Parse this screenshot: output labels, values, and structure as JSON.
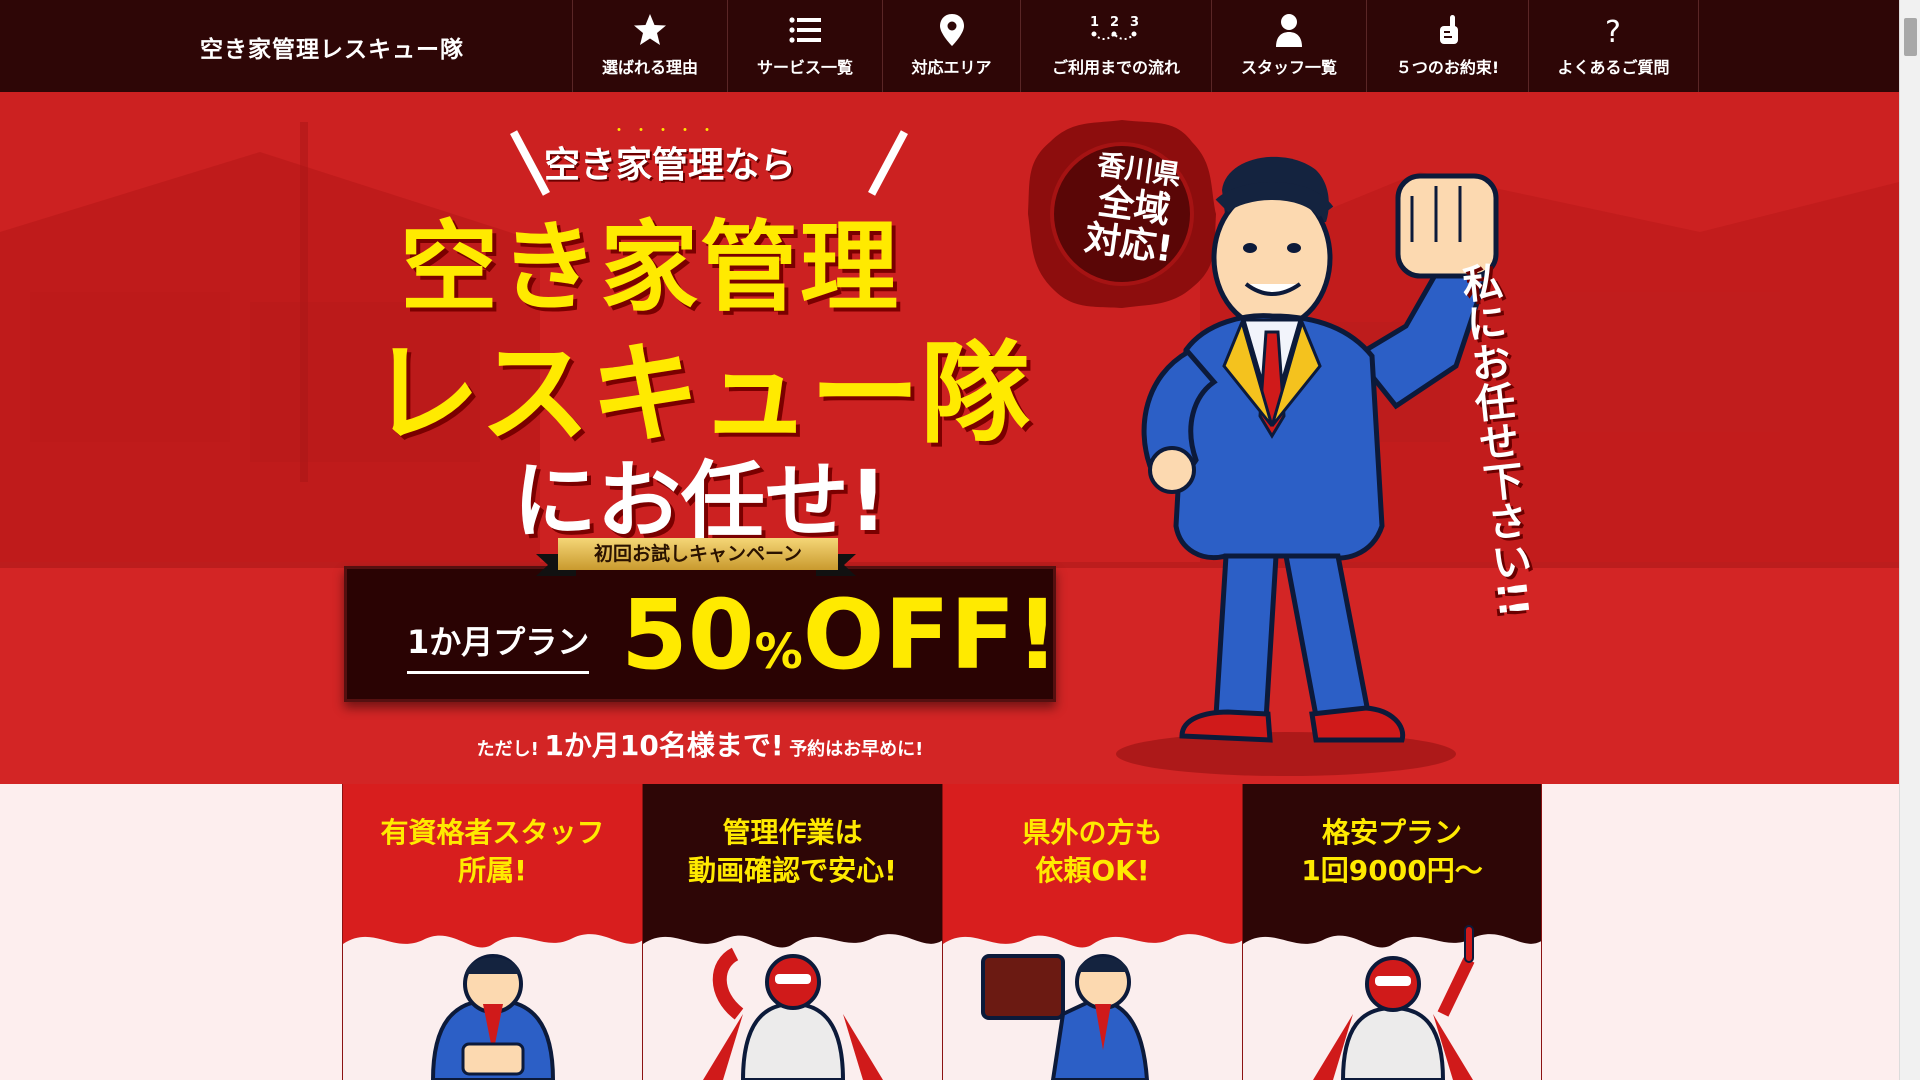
{
  "header": {
    "logo": "空き家管理レスキュー隊",
    "nav": [
      {
        "label": "選ばれる理由",
        "icon": "star-icon"
      },
      {
        "label": "サービス一覧",
        "icon": "list-icon"
      },
      {
        "label": "対応エリア",
        "icon": "map-pin-icon"
      },
      {
        "label": "ご利用までの流れ",
        "icon": "steps-icon"
      },
      {
        "label": "スタッフ一覧",
        "icon": "person-icon"
      },
      {
        "label": "５つのお約束!",
        "icon": "pinky-promise-icon"
      },
      {
        "label": "よくあるご質問",
        "icon": "question-icon"
      }
    ]
  },
  "hero": {
    "catch_dots": "・・・・・",
    "catch": "空き家管理なら",
    "title_line1": "空き家管理",
    "title_line2": "レスキュー隊",
    "title_line3": "にお任せ!",
    "campaign": "初回お試しキャンペーン",
    "plan": "1か月プラン",
    "discount_num": "50",
    "discount_pct": "%",
    "discount_off": "OFF!",
    "note_a": "ただし!",
    "note_b": "1か月10名様まで!",
    "note_c": "予約はお早めに!",
    "seal_line1": "香川県",
    "seal_line2": "全域",
    "seal_line3": "対応!",
    "vertical_text": "私にお任せ下さい!!"
  },
  "features": [
    {
      "line1": "有資格者スタッフ",
      "line2": "所属!",
      "theme": "red"
    },
    {
      "line1": "管理作業は",
      "line2": "動画確認で安心!",
      "theme": "dark"
    },
    {
      "line1": "県外の方も",
      "line2": "依頼OK!",
      "theme": "red"
    },
    {
      "line1": "格安プラン",
      "line2": "1回9000円〜",
      "theme": "dark"
    }
  ],
  "colors": {
    "header_bg": "#2e0606",
    "hero_red": "#d42424",
    "accent_yellow": "#ffea00",
    "page_bg": "#fdeeee"
  }
}
